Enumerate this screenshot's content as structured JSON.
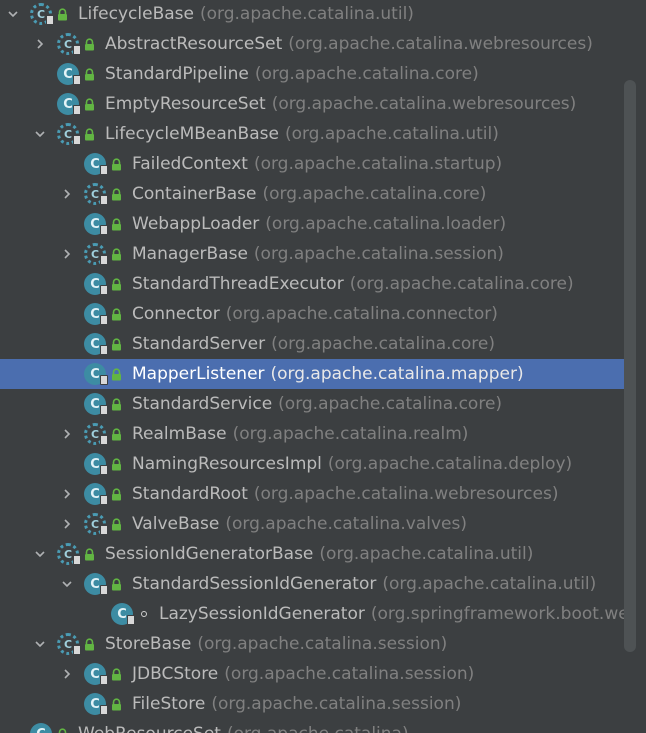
{
  "tree": {
    "rows": [
      {
        "name": "LifecycleBase",
        "pkg": "(org.apache.catalina.util)",
        "depth": 0,
        "arrow": "down",
        "abstract": true,
        "marker": "lock",
        "selected": false
      },
      {
        "name": "AbstractResourceSet",
        "pkg": "(org.apache.catalina.webresources)",
        "depth": 1,
        "arrow": "right",
        "abstract": true,
        "marker": "lock",
        "selected": false
      },
      {
        "name": "StandardPipeline",
        "pkg": "(org.apache.catalina.core)",
        "depth": 1,
        "arrow": "none",
        "abstract": false,
        "marker": "lock",
        "selected": false
      },
      {
        "name": "EmptyResourceSet",
        "pkg": "(org.apache.catalina.webresources)",
        "depth": 1,
        "arrow": "none",
        "abstract": false,
        "marker": "lock",
        "selected": false
      },
      {
        "name": "LifecycleMBeanBase",
        "pkg": "(org.apache.catalina.util)",
        "depth": 1,
        "arrow": "down",
        "abstract": true,
        "marker": "lock",
        "selected": false
      },
      {
        "name": "FailedContext",
        "pkg": "(org.apache.catalina.startup)",
        "depth": 2,
        "arrow": "none",
        "abstract": false,
        "marker": "lock",
        "selected": false
      },
      {
        "name": "ContainerBase",
        "pkg": "(org.apache.catalina.core)",
        "depth": 2,
        "arrow": "right",
        "abstract": true,
        "marker": "lock",
        "selected": false
      },
      {
        "name": "WebappLoader",
        "pkg": "(org.apache.catalina.loader)",
        "depth": 2,
        "arrow": "none",
        "abstract": false,
        "marker": "lock",
        "selected": false
      },
      {
        "name": "ManagerBase",
        "pkg": "(org.apache.catalina.session)",
        "depth": 2,
        "arrow": "right",
        "abstract": true,
        "marker": "lock",
        "selected": false
      },
      {
        "name": "StandardThreadExecutor",
        "pkg": "(org.apache.catalina.core)",
        "depth": 2,
        "arrow": "none",
        "abstract": false,
        "marker": "lock",
        "selected": false
      },
      {
        "name": "Connector",
        "pkg": "(org.apache.catalina.connector)",
        "depth": 2,
        "arrow": "none",
        "abstract": false,
        "marker": "lock",
        "selected": false
      },
      {
        "name": "StandardServer",
        "pkg": "(org.apache.catalina.core)",
        "depth": 2,
        "arrow": "none",
        "abstract": false,
        "marker": "lock",
        "selected": false
      },
      {
        "name": "MapperListener",
        "pkg": "(org.apache.catalina.mapper)",
        "depth": 2,
        "arrow": "none",
        "abstract": false,
        "marker": "lock",
        "selected": true
      },
      {
        "name": "StandardService",
        "pkg": "(org.apache.catalina.core)",
        "depth": 2,
        "arrow": "none",
        "abstract": false,
        "marker": "lock",
        "selected": false
      },
      {
        "name": "RealmBase",
        "pkg": "(org.apache.catalina.realm)",
        "depth": 2,
        "arrow": "right",
        "abstract": true,
        "marker": "lock",
        "selected": false
      },
      {
        "name": "NamingResourcesImpl",
        "pkg": "(org.apache.catalina.deploy)",
        "depth": 2,
        "arrow": "none",
        "abstract": false,
        "marker": "lock",
        "selected": false
      },
      {
        "name": "StandardRoot",
        "pkg": "(org.apache.catalina.webresources)",
        "depth": 2,
        "arrow": "right",
        "abstract": false,
        "marker": "lock",
        "selected": false
      },
      {
        "name": "ValveBase",
        "pkg": "(org.apache.catalina.valves)",
        "depth": 2,
        "arrow": "right",
        "abstract": true,
        "marker": "lock",
        "selected": false
      },
      {
        "name": "SessionIdGeneratorBase",
        "pkg": "(org.apache.catalina.util)",
        "depth": 1,
        "arrow": "down",
        "abstract": true,
        "marker": "lock",
        "selected": false
      },
      {
        "name": "StandardSessionIdGenerator",
        "pkg": "(org.apache.catalina.util)",
        "depth": 2,
        "arrow": "down",
        "abstract": false,
        "marker": "lock",
        "selected": false
      },
      {
        "name": "LazySessionIdGenerator",
        "pkg": "(org.springframework.boot.web",
        "depth": 3,
        "arrow": "none",
        "abstract": false,
        "marker": "dot",
        "selected": false
      },
      {
        "name": "StoreBase",
        "pkg": "(org.apache.catalina.session)",
        "depth": 1,
        "arrow": "down",
        "abstract": true,
        "marker": "lock",
        "selected": false
      },
      {
        "name": "JDBCStore",
        "pkg": "(org.apache.catalina.session)",
        "depth": 2,
        "arrow": "right",
        "abstract": false,
        "marker": "lock",
        "selected": false
      },
      {
        "name": "FileStore",
        "pkg": "(org.apache.catalina.session)",
        "depth": 2,
        "arrow": "none",
        "abstract": false,
        "marker": "lock",
        "selected": false
      },
      {
        "name": "WebResourceSet",
        "pkg": "(org.apache.catalina)",
        "depth": 0,
        "arrow": "none",
        "abstract": false,
        "marker": "lock",
        "selected": false
      }
    ]
  },
  "colors": {
    "background": "#3c3f41",
    "selection": "#4b6eaf",
    "class_icon": "#3d8ca3",
    "lock_icon": "#62b543",
    "package_text": "#808080"
  },
  "icons": {
    "expanded": "chevron-down-icon",
    "collapsed": "chevron-right-icon",
    "class": "class-icon",
    "abstract_class": "abstract-class-icon",
    "access": "lock-icon"
  }
}
